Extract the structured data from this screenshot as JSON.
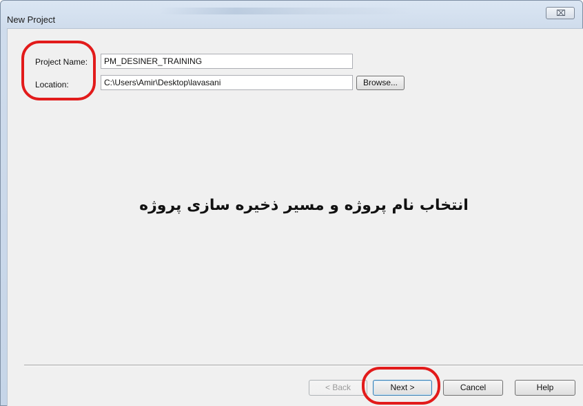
{
  "window": {
    "title": "New Project",
    "close_symbol": "⌧"
  },
  "form": {
    "project_name_label": "Project Name:",
    "project_name_value": "PM_DESINER_TRAINING",
    "location_label": "Location:",
    "location_value": "C:\\Users\\Amir\\Desktop\\lavasani",
    "browse_label": "Browse..."
  },
  "annotation": {
    "text": "انتخاب نام پروژه و مسیر ذخیره سازی پروژه",
    "highlight_color": "#e21b1b"
  },
  "footer": {
    "back_label": "< Back",
    "next_label": "Next >",
    "cancel_label": "Cancel",
    "help_label": "Help"
  }
}
